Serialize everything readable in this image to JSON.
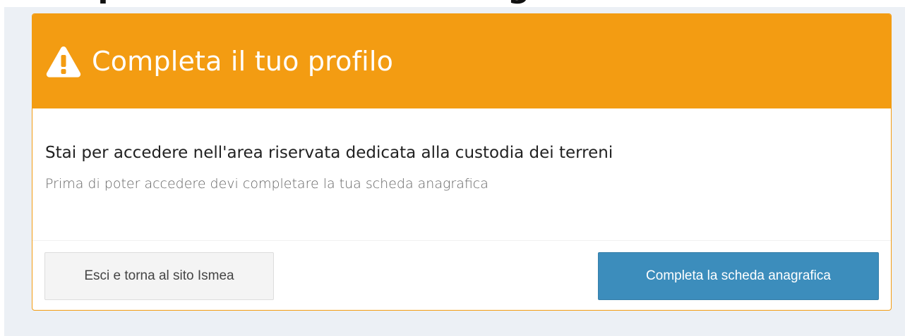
{
  "page": {
    "clipped_heading": "Completa la tua scheda anagrafica"
  },
  "modal": {
    "title": "Completa il tuo profilo",
    "title_icon": "warning-triangle-icon",
    "body_heading": "Stai per accedere nell'area riservata dedicata alla custodia dei terreni",
    "body_text": "Prima di poter accedere devi completare la tua scheda anagrafica",
    "buttons": {
      "exit_label": "Esci e torna al sito Ismea",
      "complete_label": "Completa la scheda anagrafica"
    }
  },
  "colors": {
    "header": "#f39c12",
    "primary_button": "#3c8dbc",
    "default_button": "#f4f4f4",
    "backdrop": "#ecf0f5"
  }
}
